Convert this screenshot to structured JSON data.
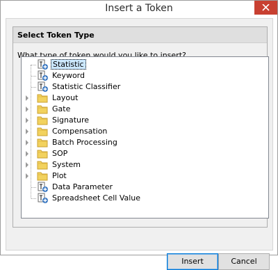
{
  "window": {
    "title": "Insert a Token"
  },
  "panel": {
    "header": "Select Token Type",
    "question": "What type of token would you like to insert?"
  },
  "tree": {
    "items": [
      {
        "label": "Statistic",
        "kind": "token",
        "selected": true
      },
      {
        "label": "Keyword",
        "kind": "token"
      },
      {
        "label": "Statistic Classifier",
        "kind": "token"
      },
      {
        "label": "Layout",
        "kind": "folder"
      },
      {
        "label": "Gate",
        "kind": "folder"
      },
      {
        "label": "Signature",
        "kind": "folder"
      },
      {
        "label": "Compensation",
        "kind": "folder"
      },
      {
        "label": "Batch Processing",
        "kind": "folder"
      },
      {
        "label": "SOP",
        "kind": "folder"
      },
      {
        "label": "System",
        "kind": "folder"
      },
      {
        "label": "Plot",
        "kind": "folder"
      },
      {
        "label": "Data Parameter",
        "kind": "token"
      },
      {
        "label": "Spreadsheet Cell Value",
        "kind": "token"
      }
    ]
  },
  "buttons": {
    "insert": "Insert",
    "cancel": "Cancel"
  },
  "colors": {
    "close": "#c84031",
    "folder": "#f2d25e",
    "token_blue": "#3a78c2",
    "selection": "#cce8ff"
  },
  "icons": {
    "close": "close-icon",
    "folder": "folder-icon",
    "token": "token-icon",
    "expand": "expand-arrow-icon"
  }
}
